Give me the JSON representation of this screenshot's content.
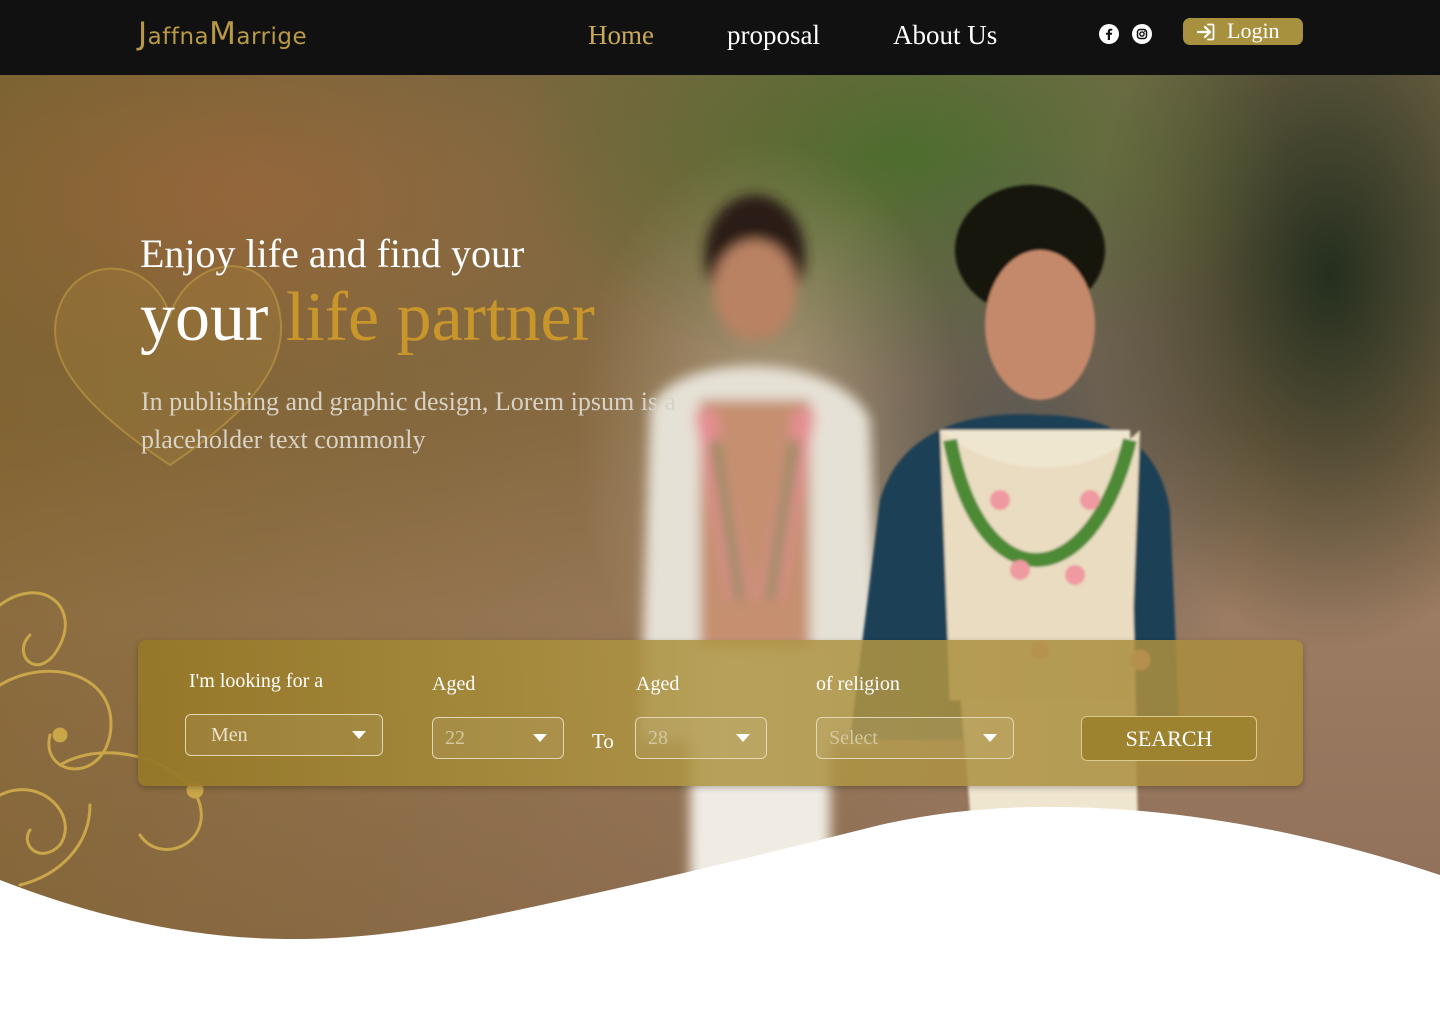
{
  "header": {
    "logo": {
      "first_letter": "J",
      "part1": "affna",
      "second_letter": "M",
      "part2": "arrige"
    },
    "nav": [
      {
        "label": "Home",
        "active": true
      },
      {
        "label": "proposal",
        "active": false
      },
      {
        "label": "About Us",
        "active": false
      }
    ],
    "social": [
      "facebook-icon",
      "instagram-icon"
    ],
    "login_label": "Login",
    "colors": {
      "bar": "#121111",
      "accent": "#c9aa5c",
      "login_bg": "#a8913e"
    }
  },
  "hero": {
    "line1": "Enjoy life and find your",
    "line2_plain": "your ",
    "line2_accent": "life partner",
    "subtitle": "In publishing and graphic design, Lorem ipsum is a placeholder text commonly",
    "accent_color": "#c9962c"
  },
  "search": {
    "looking_for_label": "I'm looking for a",
    "looking_for_value": "Men",
    "aged_from_label": "Aged",
    "aged_from_value": "22",
    "to_label": "To",
    "aged_to_label": "Aged",
    "aged_to_value": "28",
    "religion_label": "of religion",
    "religion_placeholder": "Select",
    "button_label": "SEARCH"
  }
}
